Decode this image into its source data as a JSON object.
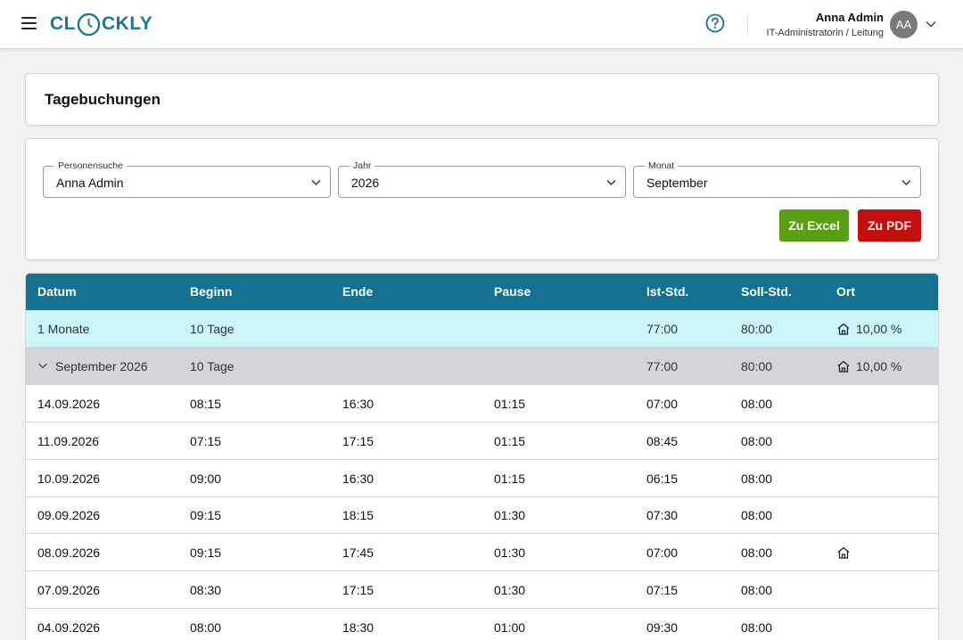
{
  "header": {
    "logo_text_left": "CL",
    "logo_text_right": "CKLY",
    "user_name": "Anna Admin",
    "user_role": "IT-Administratorin / Leitung",
    "avatar_initials": "AA",
    "brand_color": "#1a7a8f"
  },
  "page": {
    "title": "Tagebuchungen"
  },
  "filters": {
    "person": {
      "label": "Personensuche",
      "value": "Anna Admin"
    },
    "year": {
      "label": "Jahr",
      "value": "2026"
    },
    "month": {
      "label": "Monat",
      "value": "September"
    },
    "excel_label": "Zu Excel",
    "pdf_label": "Zu PDF",
    "excel_color": "#5a9e12",
    "pdf_color": "#c40f0f"
  },
  "table": {
    "header_color": "#137291",
    "columns": [
      "Datum",
      "Beginn",
      "Ende",
      "Pause",
      "Ist-Std.",
      "Soll-Std.",
      "Ort"
    ],
    "summary": {
      "datum": "1 Monate",
      "beginn": "10 Tage",
      "ist": "77:00",
      "soll": "80:00",
      "ort_icon": "home-icon",
      "ort_pct": "10,00 %"
    },
    "month_group": {
      "datum": "September 2026",
      "beginn": "10 Tage",
      "ist": "77:00",
      "soll": "80:00",
      "ort_icon": "home-icon",
      "ort_pct": "10,00 %"
    },
    "rows": [
      {
        "datum": "14.09.2026",
        "beginn": "08:15",
        "ende": "16:30",
        "pause": "01:15",
        "ist": "07:00",
        "soll": "08:00",
        "home": false
      },
      {
        "datum": "11.09.2026",
        "beginn": "07:15",
        "ende": "17:15",
        "pause": "01:15",
        "ist": "08:45",
        "soll": "08:00",
        "home": false
      },
      {
        "datum": "10.09.2026",
        "beginn": "09:00",
        "ende": "16:30",
        "pause": "01:15",
        "ist": "06:15",
        "soll": "08:00",
        "home": false
      },
      {
        "datum": "09.09.2026",
        "beginn": "09:15",
        "ende": "18:15",
        "pause": "01:30",
        "ist": "07:30",
        "soll": "08:00",
        "home": false
      },
      {
        "datum": "08.09.2026",
        "beginn": "09:15",
        "ende": "17:45",
        "pause": "01:30",
        "ist": "07:00",
        "soll": "08:00",
        "home": true
      },
      {
        "datum": "07.09.2026",
        "beginn": "08:30",
        "ende": "17:15",
        "pause": "01:30",
        "ist": "07:15",
        "soll": "08:00",
        "home": false
      },
      {
        "datum": "04.09.2026",
        "beginn": "08:00",
        "ende": "18:30",
        "pause": "01:00",
        "ist": "09:30",
        "soll": "08:00",
        "home": false
      }
    ]
  }
}
